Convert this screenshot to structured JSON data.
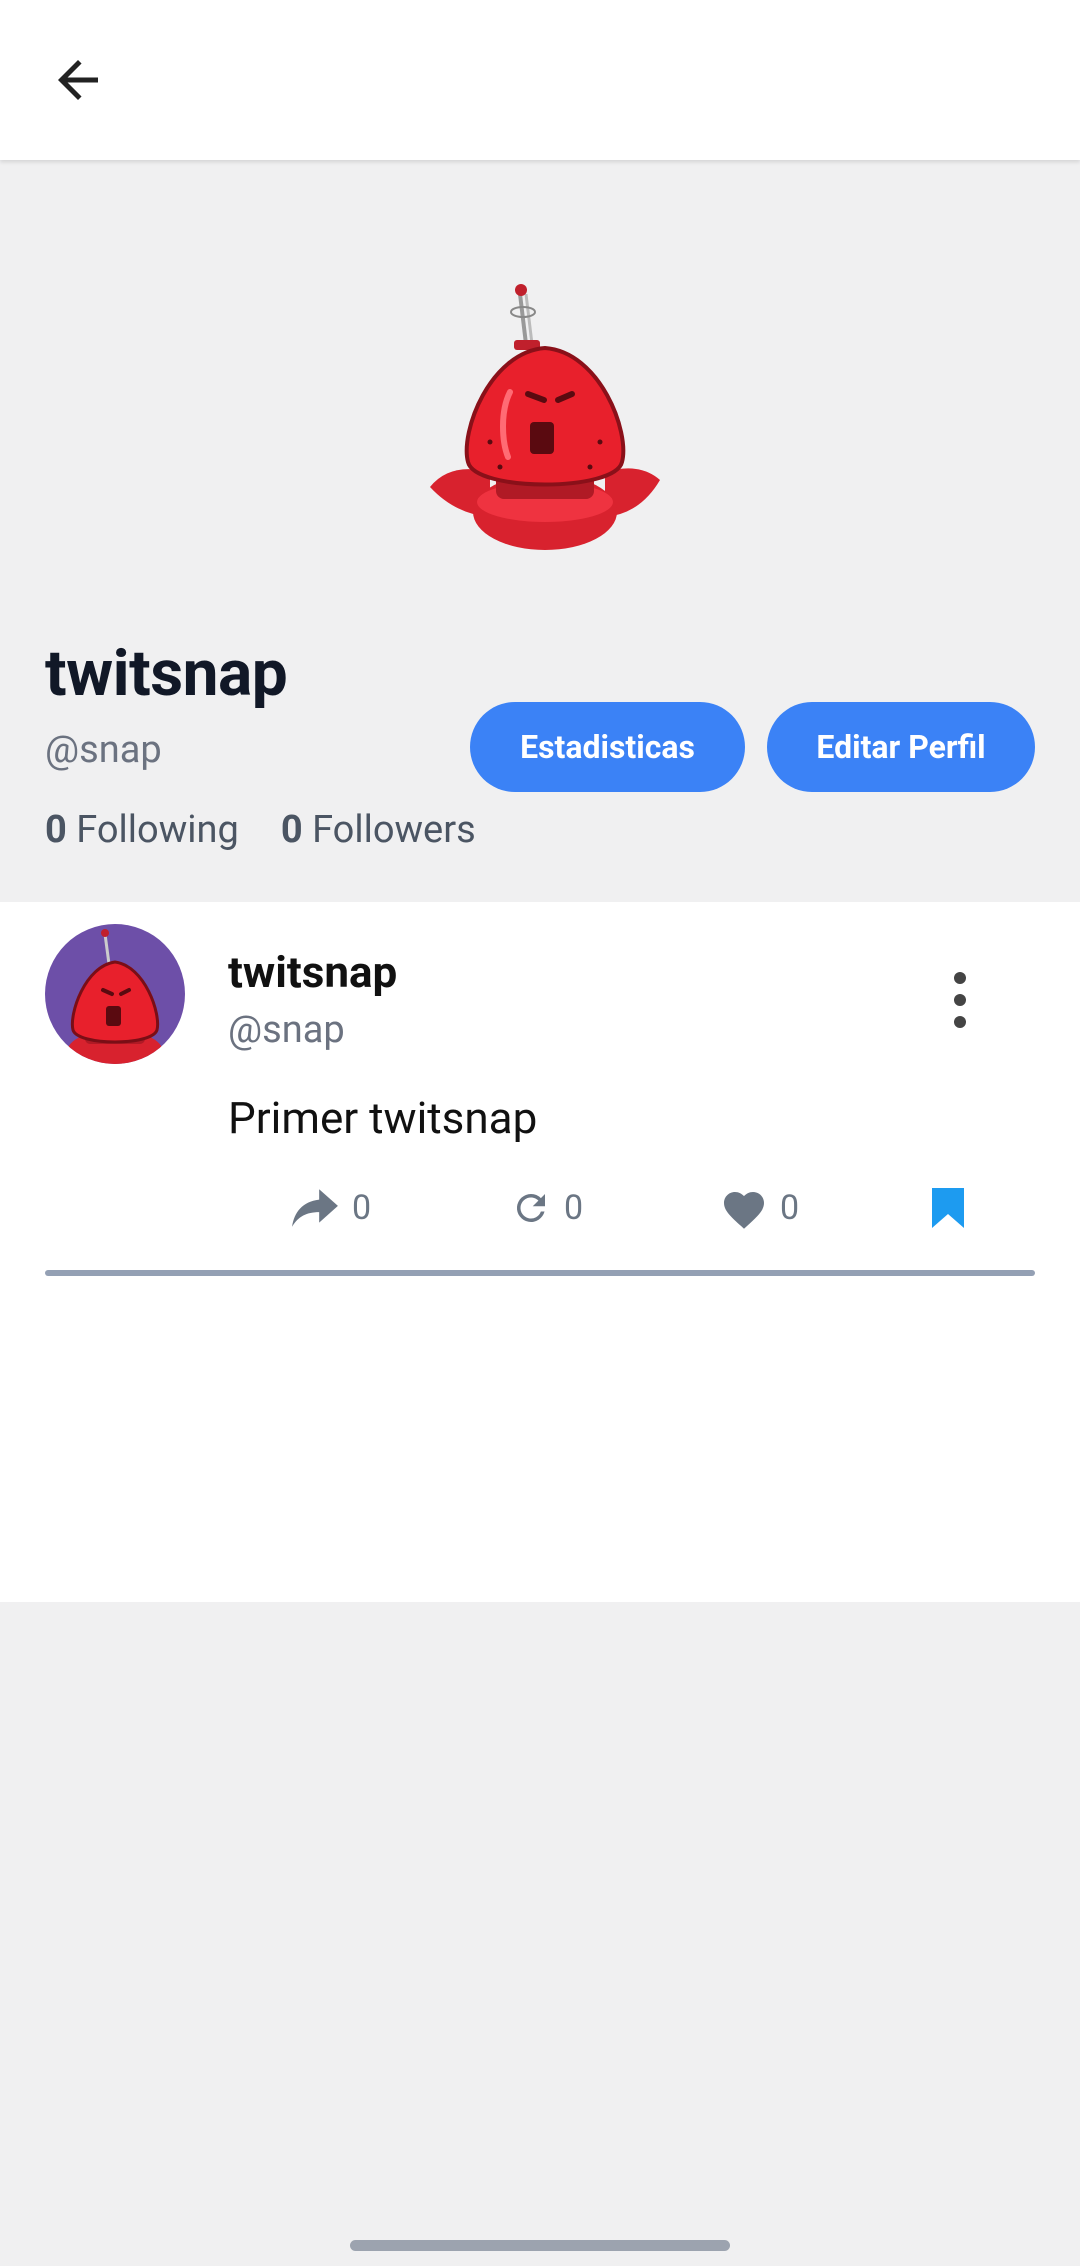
{
  "appbar": {
    "back_icon": "arrow-left-icon"
  },
  "profile": {
    "display_name": "twitsnap",
    "username": "@snap",
    "following_count": "0",
    "following_label": "Following",
    "followers_count": "0",
    "followers_label": "Followers",
    "buttons": {
      "stats_label": "Estadisticas",
      "edit_label": "Editar Perfil"
    },
    "accent_color": "#3b82f6"
  },
  "feed": {
    "posts": [
      {
        "author_name": "twitsnap",
        "author_username": "@snap",
        "text": "Primer twitsnap",
        "share_count": "0",
        "retweet_count": "0",
        "like_count": "0",
        "bookmark_color": "#1d9bf0"
      }
    ]
  }
}
